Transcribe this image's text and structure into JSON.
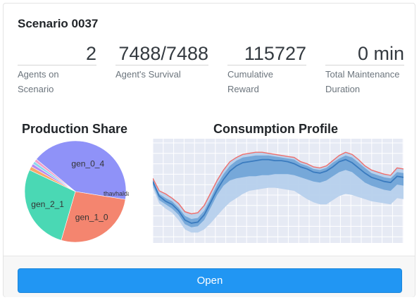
{
  "card": {
    "title": "Scenario 0037",
    "kpis": [
      {
        "value": "2",
        "label": "Agents on Scenario"
      },
      {
        "value": "7488/7488",
        "label": "Agent's Survival"
      },
      {
        "value": "115727",
        "label": "Cumulative Reward"
      },
      {
        "value": "0 min",
        "label": "Total Maintenance Duration"
      }
    ],
    "open_label": "Open"
  },
  "chart_data": [
    {
      "type": "pie",
      "title": "Production Share",
      "labels": [
        "gen_0_4",
        "gen_1_0",
        "gen_2_1",
        "",
        "",
        "",
        ""
      ],
      "values": [
        41.5,
        27.0,
        27.5,
        1.2,
        1.0,
        0.9,
        0.9
      ],
      "colors": [
        "#8f92f8",
        "#f4856f",
        "#4ad8b4",
        "#f8a86b",
        "#b78bf0",
        "#8ad7ee",
        "#f2a0c9"
      ],
      "overlapping_small_labels": "thavhaldal"
    },
    {
      "type": "area",
      "title": "Consumption Profile",
      "grid": true,
      "ylim": [
        0,
        100
      ],
      "series": [
        {
          "role": "max",
          "color": "#ef6f6c",
          "values": [
            62,
            50,
            47,
            43,
            38,
            30,
            28,
            29,
            36,
            48,
            60,
            70,
            78,
            82,
            85,
            86,
            87,
            87,
            86,
            85,
            84,
            83,
            82,
            78,
            76,
            73,
            72,
            74,
            79,
            84,
            87,
            85,
            80,
            74,
            70,
            68,
            66,
            65,
            72,
            71
          ]
        },
        {
          "role": "mean",
          "color": "#3a7bbf",
          "values": [
            59,
            45,
            40,
            37,
            31,
            22,
            19,
            20,
            27,
            39,
            51,
            61,
            69,
            74,
            77,
            78,
            79,
            80,
            80,
            79,
            79,
            78,
            76,
            73,
            71,
            68,
            67,
            69,
            73,
            78,
            80,
            77,
            72,
            67,
            63,
            61,
            59,
            58,
            64,
            63
          ]
        },
        {
          "role": "band_inner_high",
          "values": [
            61,
            47,
            43,
            40,
            34,
            26,
            23,
            24,
            31,
            43,
            56,
            66,
            74,
            79,
            82,
            83,
            84,
            84,
            84,
            83,
            82,
            81,
            80,
            76,
            74,
            71,
            70,
            72,
            77,
            81,
            84,
            82,
            77,
            72,
            67,
            65,
            63,
            62,
            68,
            67
          ]
        },
        {
          "role": "band_inner_low",
          "values": [
            56,
            41,
            37,
            33,
            27,
            18,
            15,
            16,
            22,
            34,
            46,
            55,
            60,
            62,
            63,
            64,
            64,
            65,
            65,
            66,
            66,
            66,
            65,
            63,
            61,
            59,
            58,
            60,
            64,
            68,
            70,
            68,
            63,
            58,
            55,
            53,
            51,
            50,
            56,
            55
          ]
        },
        {
          "role": "band_outer_low",
          "values": [
            53,
            38,
            33,
            29,
            22,
            13,
            10,
            10,
            13,
            19,
            26,
            33,
            39,
            43,
            47,
            50,
            51,
            52,
            53,
            53,
            52,
            51,
            50,
            46,
            42,
            39,
            37,
            37,
            41,
            45,
            47,
            46,
            44,
            42,
            40,
            39,
            38,
            37,
            43,
            42
          ]
        }
      ],
      "colors": {
        "band_outer": "#b6d0ec",
        "band_inner": "#6fa3d6",
        "background": "#e6eaf4"
      }
    }
  ]
}
